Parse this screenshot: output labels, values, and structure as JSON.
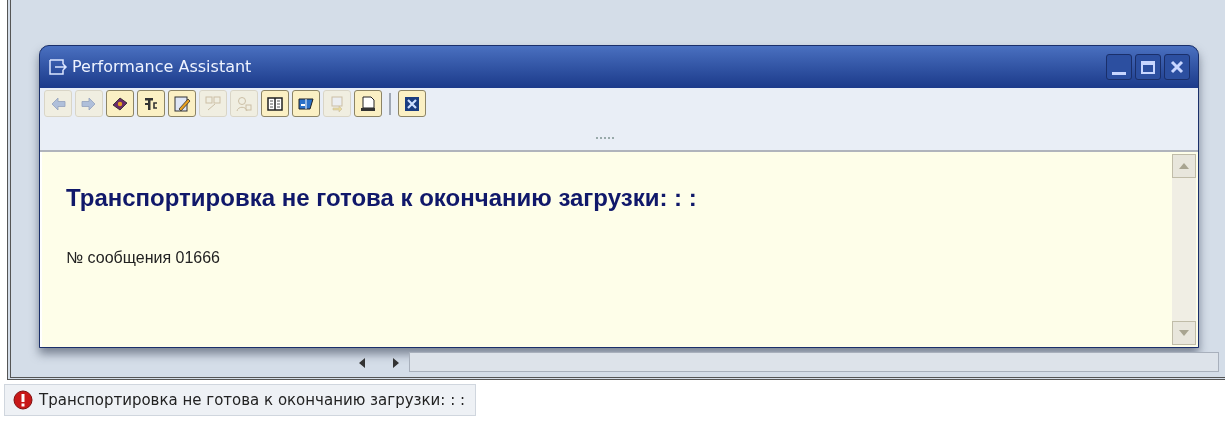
{
  "dialog": {
    "title": "Performance Assistant",
    "toolbar": [
      {
        "disabled": true
      },
      {
        "disabled": true
      },
      {
        "disabled": false
      },
      {
        "disabled": false
      },
      {
        "disabled": false
      },
      {
        "disabled": true
      },
      {
        "disabled": true
      },
      {
        "disabled": false
      },
      {
        "disabled": false
      },
      {
        "disabled": true
      },
      {
        "disabled": false
      },
      {
        "disabled": false
      }
    ],
    "heading": "Транспортировка не готова к окончанию загрузки: : :",
    "message": "№ сообщения 01666"
  },
  "status_bar": {
    "kind": "error",
    "text": "Транспортировка не готова к окончанию загрузки: : :"
  }
}
